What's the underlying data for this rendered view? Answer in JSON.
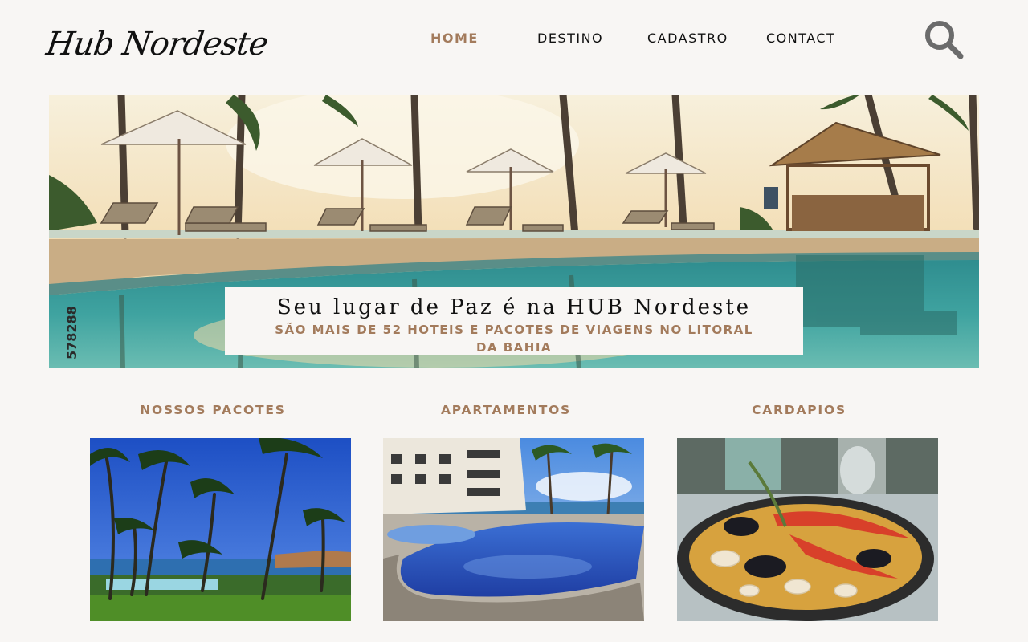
{
  "brand": {
    "logo_text": "Hub Nordeste"
  },
  "nav": {
    "items": [
      {
        "label": "HOME",
        "active": true
      },
      {
        "label": "DESTINO",
        "active": false
      },
      {
        "label": "CADASTRO",
        "active": false
      },
      {
        "label": "CONTACT",
        "active": false
      }
    ],
    "search_icon": "search-icon"
  },
  "hero": {
    "image": "resort-pool-with-beach-umbrellas",
    "title": "Seu lugar de Paz é na HUB Nordeste",
    "subtitle": "SÃO MAIS DE 52 HOTEIS E PACOTES DE VIAGENS NO LITORAL DA BAHIA"
  },
  "sections": [
    {
      "heading": "NOSSOS PACOTES",
      "image": "beach-palm-trees-photo"
    },
    {
      "heading": "APARTAMENTOS",
      "image": "apartment-pool-photo"
    },
    {
      "heading": "CARDAPIOS",
      "image": "seafood-paella-photo"
    }
  ],
  "colors": {
    "accent": "#a37b5c",
    "text": "#111111",
    "background": "#f8f6f4",
    "icon": "#6b6b6b"
  }
}
